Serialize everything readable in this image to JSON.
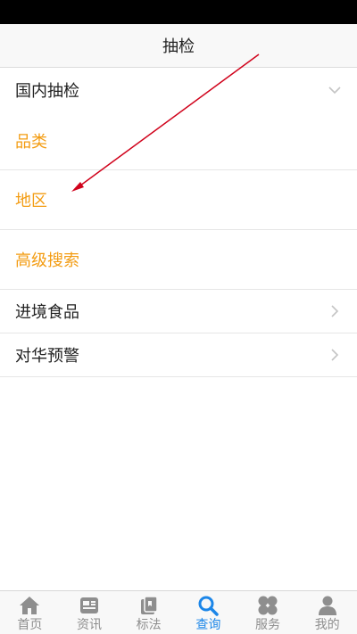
{
  "nav": {
    "title": "抽检"
  },
  "list": {
    "domestic": "国内抽检",
    "category": "品类",
    "region": "地区",
    "advanced_search": "高级搜索",
    "imported_food": "进境食品",
    "china_warning": "对华预警"
  },
  "tabs": [
    {
      "label": "首页",
      "icon": "home-icon"
    },
    {
      "label": "资讯",
      "icon": "news-icon"
    },
    {
      "label": "标法",
      "icon": "standard-icon"
    },
    {
      "label": "查询",
      "icon": "search-icon",
      "active": true
    },
    {
      "label": "服务",
      "icon": "services-icon"
    },
    {
      "label": "我的",
      "icon": "profile-icon"
    }
  ],
  "colors": {
    "accent_orange": "#f39c12",
    "tab_active": "#1c86e8",
    "tab_inactive": "#8e8e8e",
    "annotation_arrow": "#d0021b"
  }
}
